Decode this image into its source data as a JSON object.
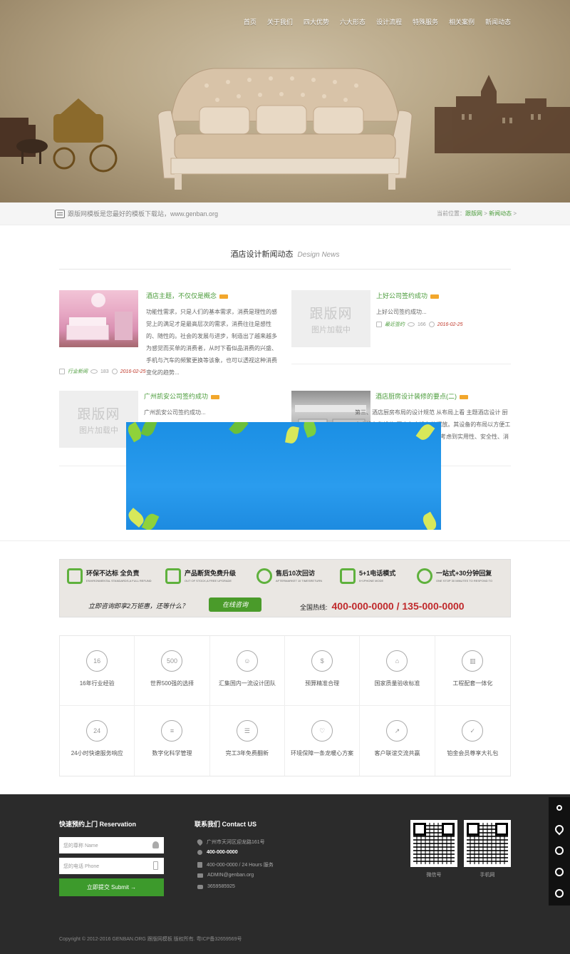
{
  "nav": {
    "items": [
      "首页",
      "关于我们",
      "四大优势",
      "六大形态",
      "设计流程",
      "特殊服务",
      "相关案例",
      "新闻动态"
    ]
  },
  "crumbbar": {
    "notice": "跟版网模板是您最好的模板下载站，www.genban.org",
    "crumb_prefix": "当前位置：",
    "crumb_home": "跟版网",
    "crumb_sep": " > ",
    "crumb_current": "新闻动态",
    "crumb_tail": " >"
  },
  "news": {
    "title_cn": "酒店设计新闻动态",
    "title_en": "Design News",
    "placeholder_big": "跟版网",
    "placeholder_small": "图片加载中",
    "items": [
      {
        "title": "酒店主题，不仅仅是概念",
        "desc": "功能性需求，只是人们的基本需求，消费是理性的感觉上的满足才是最高层次的需求，消费往往是感性的、随性的。社会的发展与进步，制造出了越来越多为感觉而买单的消费者，从时下看似品消费的兴盛、手机与汽车的频繁更换等该象，也可以透视这种消费变化的趋势...",
        "category": "行业新闻",
        "views": "183",
        "date": "2016-02-25"
      },
      {
        "title": "上好公司签约成功",
        "desc": "上好公司签约成功...",
        "category": "最近签约",
        "views": "166",
        "date": "2016-02-25"
      },
      {
        "title": "广州凯安公司签约成功",
        "desc": "广州凯安公司签约成功..."
      },
      {
        "title": "酒店厨房设计装修的要点(二)",
        "desc": "第三、酒店厨房布局的设计规范 从布局上看 主题酒店设计 厨房内设备和设施 厨房各个设备的摆放。其设备的布局以方便工作人员为主。在酒店厨房设计时应考虑到实用性、安全性、消防性能以及卫生等各"
      }
    ]
  },
  "banner": {
    "features": [
      {
        "title": "环保不达标 全负责",
        "sub": "ENVIRONMENTAL STANDARDS,A FULL REFUND"
      },
      {
        "title": "产品断货免费升级",
        "sub": "OUT OF STOCK,A FREE UPGRADE"
      },
      {
        "title": "售后10次回访",
        "sub": "AFTERMARKET 10 TIMESRETURN"
      },
      {
        "title": "5+1电话模式",
        "sub": "5+1PHONE MODE"
      },
      {
        "title": "一站式+30分钟回复",
        "sub": "ONE STOP 30 MINUTES TO RESPOND TO"
      }
    ],
    "cta": "立即咨询即享2万钜惠，还等什么？",
    "button": "在线咨询",
    "hotline_label": "全国热线:",
    "hotline_numbers": "400-000-0000 / 135-000-0000"
  },
  "grid": {
    "cells": [
      {
        "icon": "calendar-16-icon",
        "glyph": "16",
        "label": "16年行业经验"
      },
      {
        "icon": "top500-icon",
        "glyph": "500",
        "label": "世界500强的选择"
      },
      {
        "icon": "team-icon",
        "glyph": "☺",
        "label": "汇集国内一流设计团队"
      },
      {
        "icon": "budget-icon",
        "glyph": "$",
        "label": "预算精准合理"
      },
      {
        "icon": "quality-icon",
        "glyph": "⌂",
        "label": "国家质量验收标准"
      },
      {
        "icon": "integration-icon",
        "glyph": "▥",
        "label": "工程配套一体化"
      },
      {
        "icon": "phone-24-icon",
        "glyph": "24",
        "label": "24小时快速服务响应"
      },
      {
        "icon": "sliders-icon",
        "glyph": "≡",
        "label": "数字化科学管理"
      },
      {
        "icon": "warranty-icon",
        "glyph": "☰",
        "label": "完工3年免费翻新"
      },
      {
        "icon": "heart-icon",
        "glyph": "♡",
        "label": "环境保障一条龙暖心方案"
      },
      {
        "icon": "growth-icon",
        "glyph": "↗",
        "label": "客户联谊交流共赢"
      },
      {
        "icon": "shield-icon",
        "glyph": "✓",
        "label": "铂金会员尊享大礼包"
      }
    ]
  },
  "footer": {
    "reservation_title": "快速预约上门 Reservation",
    "name_placeholder": "您的尊称 Name",
    "phone_placeholder": "您的电话 Phone",
    "submit": "立即提交 Submit →",
    "contact_title": "联系我们 Contact US",
    "address": "广州市天河区迎龙路161号",
    "phone_main": "400-000-0000",
    "phone_24": "400-000-0000 / 24 Hours 服务",
    "email": "ADMIN@genban.org",
    "qq": "3659585925",
    "qr1_label": "微信号",
    "qr2_label": "手机网",
    "copyright": "Copyright © 2012-2016 GENBAN.ORG 跟版网模板 版权所有. 粤ICP备32659569号"
  },
  "colors": {
    "accent_green": "#4a9b3a",
    "date_red": "#c0392b",
    "hotline_red": "#c0292b",
    "footer_bg": "#2b2b2b",
    "popup_blue": "#2196e8"
  }
}
